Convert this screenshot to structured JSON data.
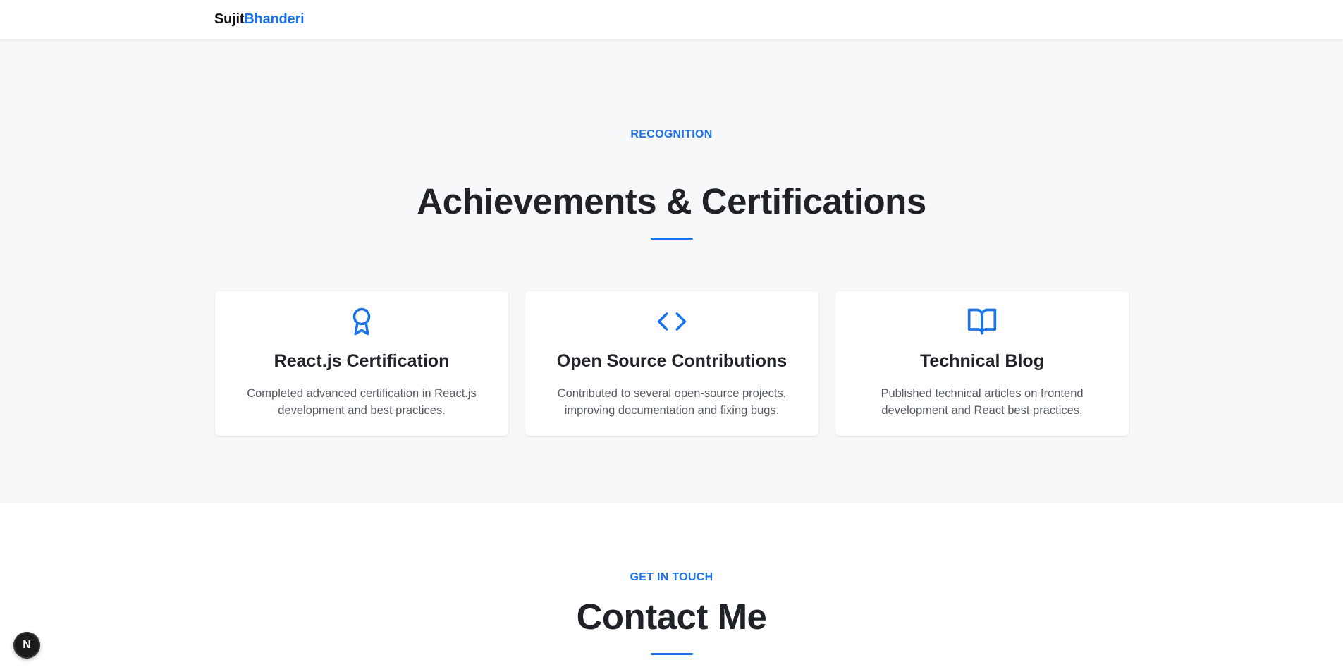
{
  "nav": {
    "logo_first": "Sujit",
    "logo_last": "Bhanderi"
  },
  "achievements": {
    "eyebrow": "RECOGNITION",
    "title": "Achievements & Certifications",
    "cards": [
      {
        "icon": "award-icon",
        "title": "React.js Certification",
        "description": "Completed advanced certification in React.js development and best practices."
      },
      {
        "icon": "code-icon",
        "title": "Open Source Contributions",
        "description": "Contributed to several open-source projects, improving documentation and fixing bugs."
      },
      {
        "icon": "book-open-icon",
        "title": "Technical Blog",
        "description": "Published technical articles on frontend development and React best practices."
      }
    ]
  },
  "contact": {
    "eyebrow": "GET IN TOUCH",
    "title": "Contact Me"
  },
  "dev_badge": {
    "label": "N"
  },
  "colors": {
    "accent": "#1a73e8",
    "section_bg": "#f7f8fa",
    "heading": "#1f2328",
    "body_text": "#555b63"
  }
}
